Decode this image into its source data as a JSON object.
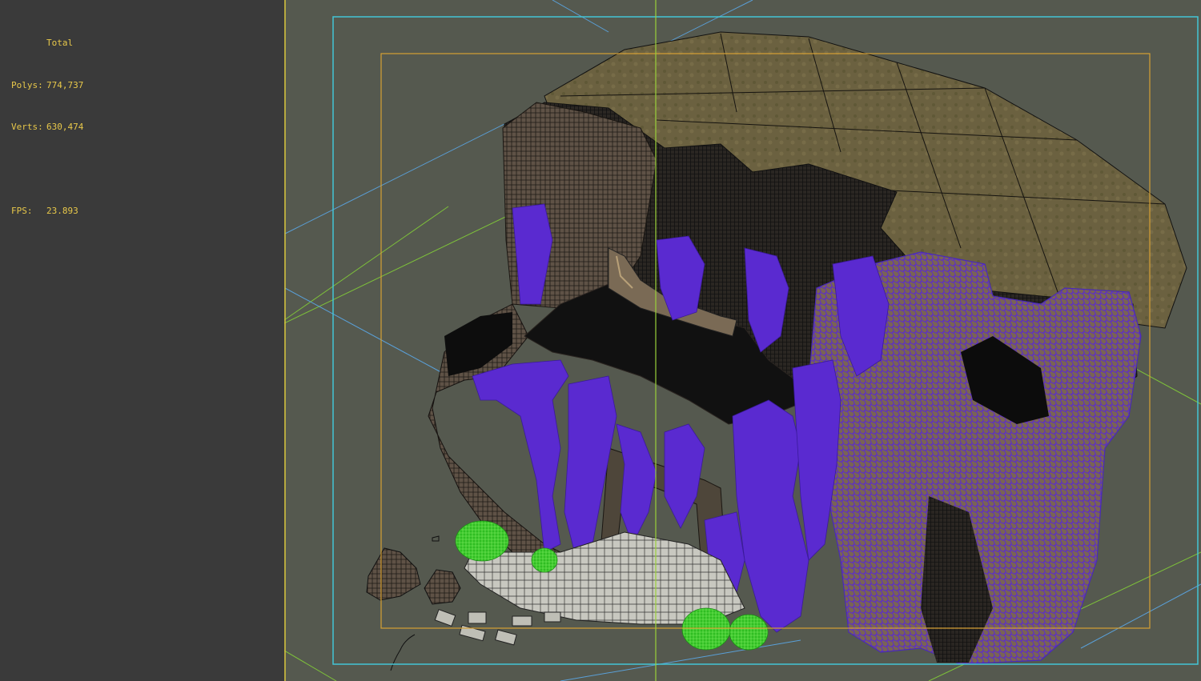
{
  "stats": {
    "header": "Total",
    "polys_label": "Polys:",
    "polys_value": "774,737",
    "verts_label": "Verts:",
    "verts_value": "630,474",
    "fps_label": "FPS:",
    "fps_value": "23.893"
  },
  "colors": {
    "viewport_bg": "#55594f",
    "panel_bg": "#3a3a3a",
    "stats_text": "#e8c84a",
    "safe_frame": "#43c5d6",
    "action_safe": "#d6a034",
    "grid_line": "#7ec23a",
    "grid_axis_blue": "#5aa0d8",
    "wire_purple": "#5a2ad0",
    "wire_green": "#3ad22a",
    "rock": "#6a5a4a",
    "terrain": "#6b6140"
  },
  "scene": {
    "description_icons": [
      "rock-wireframe",
      "waterfall-vines",
      "temple-gate",
      "stone-steps",
      "shrubs",
      "terrain-plateau"
    ]
  }
}
